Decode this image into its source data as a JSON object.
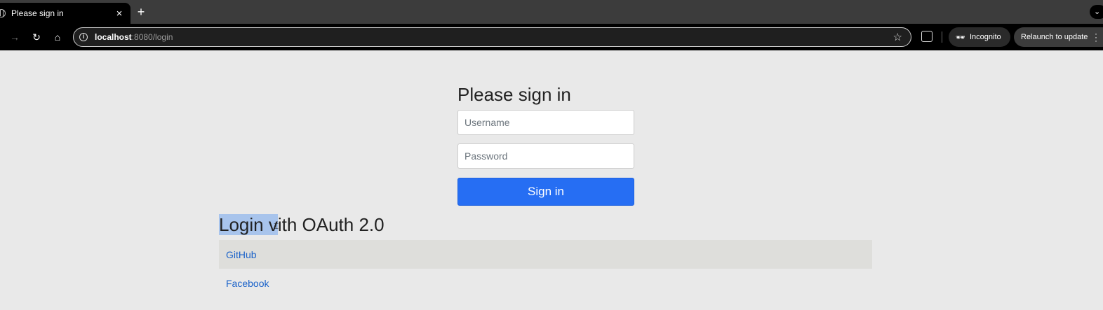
{
  "browser": {
    "tab_title": "Please sign in",
    "close_glyph": "×",
    "new_tab_glyph": "+",
    "tabs_menu_glyph": "⌄",
    "url_host": "localhost",
    "url_rest": ":8080/login",
    "incognito_label": "Incognito",
    "relaunch_label": "Relaunch to update"
  },
  "login": {
    "title": "Please sign in",
    "username_placeholder": "Username",
    "password_placeholder": "Password",
    "submit_label": "Sign in"
  },
  "oauth": {
    "title_selected": "Login v",
    "title_rest": "with OAuth 2.0",
    "providers": [
      {
        "label": "GitHub"
      },
      {
        "label": "Facebook"
      }
    ]
  },
  "icons": {
    "favicon": "globe-icon",
    "back": "back-arrow-icon",
    "forward": "forward-arrow-icon",
    "reload": "reload-icon",
    "home": "home-icon",
    "site_info": "site-info-icon",
    "bookmark": "star-icon",
    "extensions": "puzzle-icon",
    "incognito": "incognito-icon",
    "menu": "kebab-menu-icon"
  },
  "colors": {
    "page_bg": "#e9e9e9",
    "button_bg": "#266ef3",
    "link": "#1a62c9",
    "selection": "#a8c4ec"
  }
}
